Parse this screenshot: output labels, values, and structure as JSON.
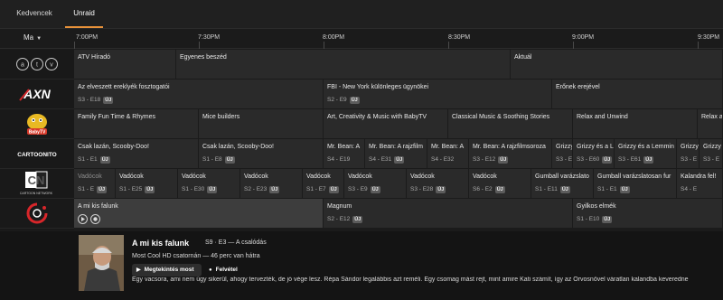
{
  "tabs": [
    {
      "label": "Kedvencek",
      "active": false
    },
    {
      "label": "Unraid",
      "active": true
    }
  ],
  "timeline": {
    "day_label": "Ma",
    "times": [
      "7:00PM",
      "7:30PM",
      "8:00PM",
      "8:30PM",
      "9:00PM",
      "9:30PM"
    ]
  },
  "badge_new": "ÚJ",
  "channels": [
    {
      "name": "ATV",
      "logo_icon": "atv-logo-icon",
      "programs": [
        {
          "title": "ATV Híradó"
        },
        {
          "title": "Egyenes beszéd"
        },
        {
          "title": "Aktuál"
        }
      ]
    },
    {
      "name": "AXN",
      "logo_icon": "axn-logo-icon",
      "logo_text": "AXN",
      "programs": [
        {
          "title": "Az elveszett ereklyék fosztogatói",
          "ep": "S3 - E18",
          "new": true
        },
        {
          "title": "FBI - New York különleges ügynökei",
          "ep": "S2 - E9",
          "new": true
        },
        {
          "title": "Erőnek erejével"
        }
      ]
    },
    {
      "name": "BabyTV",
      "logo_icon": "babytv-logo-icon",
      "logo_text": "BabyTV",
      "programs": [
        {
          "title": "Family Fun Time & Rhymes"
        },
        {
          "title": "Mice builders"
        },
        {
          "title": "Art, Creativity & Music with BabyTV"
        },
        {
          "title": "Classical Music & Soothing Stories"
        },
        {
          "title": "Relax and Unwind"
        },
        {
          "title": "Relax a"
        }
      ]
    },
    {
      "name": "Cartoonito",
      "logo_icon": "cartoonito-logo-icon",
      "logo_text": "CARTOONITO",
      "programs": [
        {
          "title": "Csak lazán, Scooby-Doo!",
          "ep": "S1 - E1",
          "new": true
        },
        {
          "title": "Csak lazán, Scooby-Doo!",
          "ep": "S1 - E8",
          "new": true
        },
        {
          "title": "Mr. Bean: A",
          "ep": "S4 - E19"
        },
        {
          "title": "Mr. Bean: A rajzfilm",
          "ep": "S4 - E31",
          "new": true
        },
        {
          "title": "Mr. Bean: A",
          "ep": "S4 - E32"
        },
        {
          "title": "Mr. Bean: A rajzfilmsoroza",
          "ep": "S3 - E12",
          "new": true
        },
        {
          "title": "Grizzy",
          "ep": "S3 - E"
        },
        {
          "title": "Grizzy és a L",
          "ep": "S3 - E60",
          "new": true
        },
        {
          "title": "Grizzy és a Lemmin",
          "ep": "S3 - E61",
          "new": true
        },
        {
          "title": "Grizzy",
          "ep": "S3 - E"
        },
        {
          "title": "Grizzy",
          "ep": "S3 - E"
        }
      ]
    },
    {
      "name": "Cartoon Network",
      "logo_icon": "cartoon-network-logo-icon",
      "logo_text": "CN",
      "logo_sub": "CARTOON NETWORK",
      "programs": [
        {
          "title": "Vadócok",
          "ep": "S1 - E",
          "new": true
        },
        {
          "title": "Vadócok",
          "ep": "S1 - E25",
          "new": true
        },
        {
          "title": "Vadócok",
          "ep": "S1 - E30",
          "new": true
        },
        {
          "title": "Vadócok",
          "ep": "S2 - E23",
          "new": true
        },
        {
          "title": "Vadócok",
          "ep": "S1 - E7",
          "new": true
        },
        {
          "title": "Vadócok",
          "ep": "S3 - E9",
          "new": true
        },
        {
          "title": "Vadócok",
          "ep": "S3 - E28",
          "new": true
        },
        {
          "title": "Vadócok",
          "ep": "S6 - E2",
          "new": true
        },
        {
          "title": "Gumball varázslato",
          "ep": "S1 - E11",
          "new": true
        },
        {
          "title": "Gumball varázslatosan fur",
          "ep": "S1 - E1",
          "new": true
        },
        {
          "title": "Kalandra fel!",
          "ep": "S4 - E"
        }
      ]
    },
    {
      "name": "Cool",
      "logo_icon": "cool-logo-icon",
      "programs": [
        {
          "title": "A mi kis falunk"
        },
        {
          "title": "Magnum",
          "ep": "S2 - E12",
          "new": true
        },
        {
          "title": "Gyilkos elmék",
          "ep": "S1 - E10",
          "new": true
        }
      ]
    }
  ],
  "detail": {
    "title": "A mi kis falunk",
    "episode": "S9 · E3 — A csalódás",
    "channel_line": "Most Cool HD csatornán — 46 perc van hátra",
    "watch_label": "Megtekintés most",
    "record_label": "Felvétel",
    "description": "Egy vacsora, ami nem úgy sikerül, ahogy tervezték, de jó vége lesz. Répa Sándor legalábbis azt reméli. Egy csomag mást rejt, mint amire Kati számít, így az Orvosnővel váratlan kalandba keveredne"
  },
  "colors": {
    "accent": "#e8923a",
    "cell": "#2a2a2a",
    "selected": "#3d3d3d",
    "background": "#1b1b1b"
  }
}
